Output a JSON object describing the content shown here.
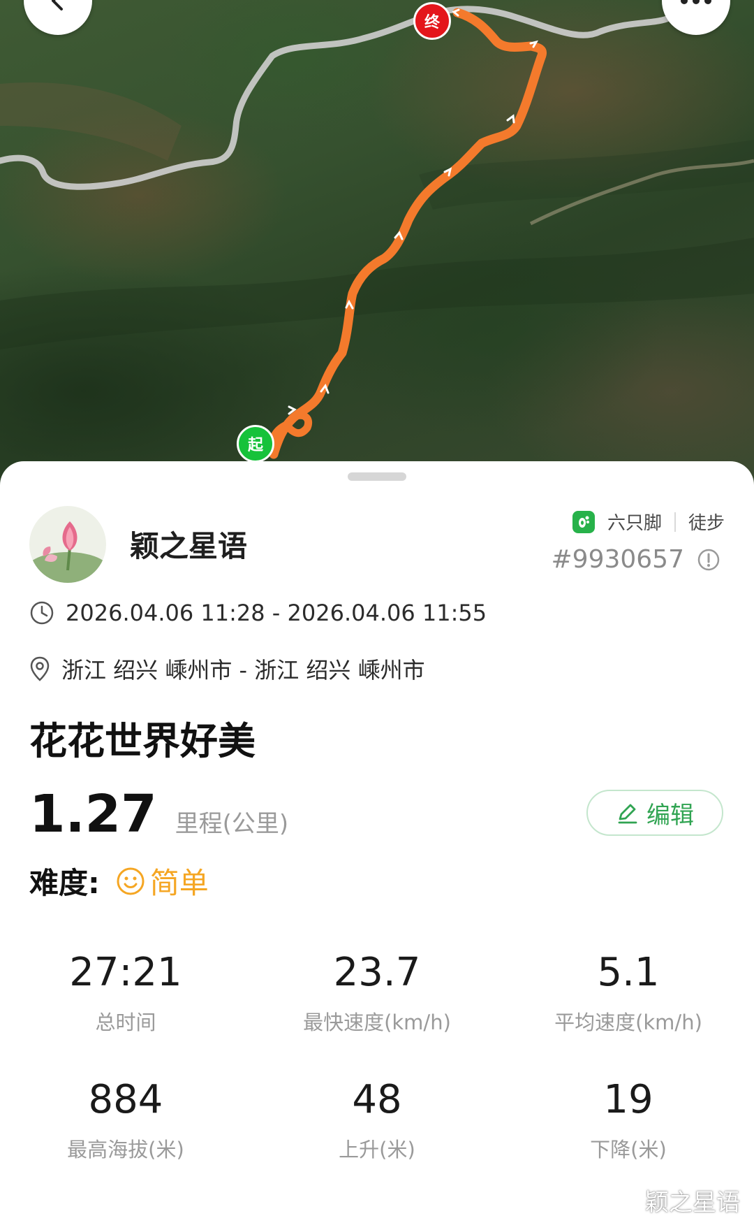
{
  "map": {
    "start_marker": "起",
    "end_marker": "终",
    "back_icon": "back-arrow-icon",
    "more_icon": "more-dots-icon",
    "colors": {
      "route": "#f47a2c",
      "road": "#c9c9c9"
    }
  },
  "profile": {
    "username": "颖之星语",
    "app_name": "六只脚",
    "activity_type": "徒步",
    "record_id": "#9930657"
  },
  "trip": {
    "time_range": "2026.04.06 11:28 - 2026.04.06 11:55",
    "location": "浙江 绍兴 嵊州市 - 浙江 绍兴 嵊州市",
    "title": "花花世界好美",
    "distance_value": "1.27",
    "distance_unit": "里程(公里)",
    "edit_label": "编辑",
    "difficulty_label": "难度:",
    "difficulty_value": "简单"
  },
  "stats": [
    {
      "value": "27:21",
      "label": "总时间"
    },
    {
      "value": "23.7",
      "label": "最快速度(km/h)"
    },
    {
      "value": "5.1",
      "label": "平均速度(km/h)"
    },
    {
      "value": "884",
      "label": "最高海拔(米)"
    },
    {
      "value": "48",
      "label": "上升(米)"
    },
    {
      "value": "19",
      "label": "下降(米)"
    }
  ],
  "watermark": "颖之星语",
  "colors": {
    "accent_green": "#30a452",
    "difficulty_orange": "#f5a623"
  }
}
